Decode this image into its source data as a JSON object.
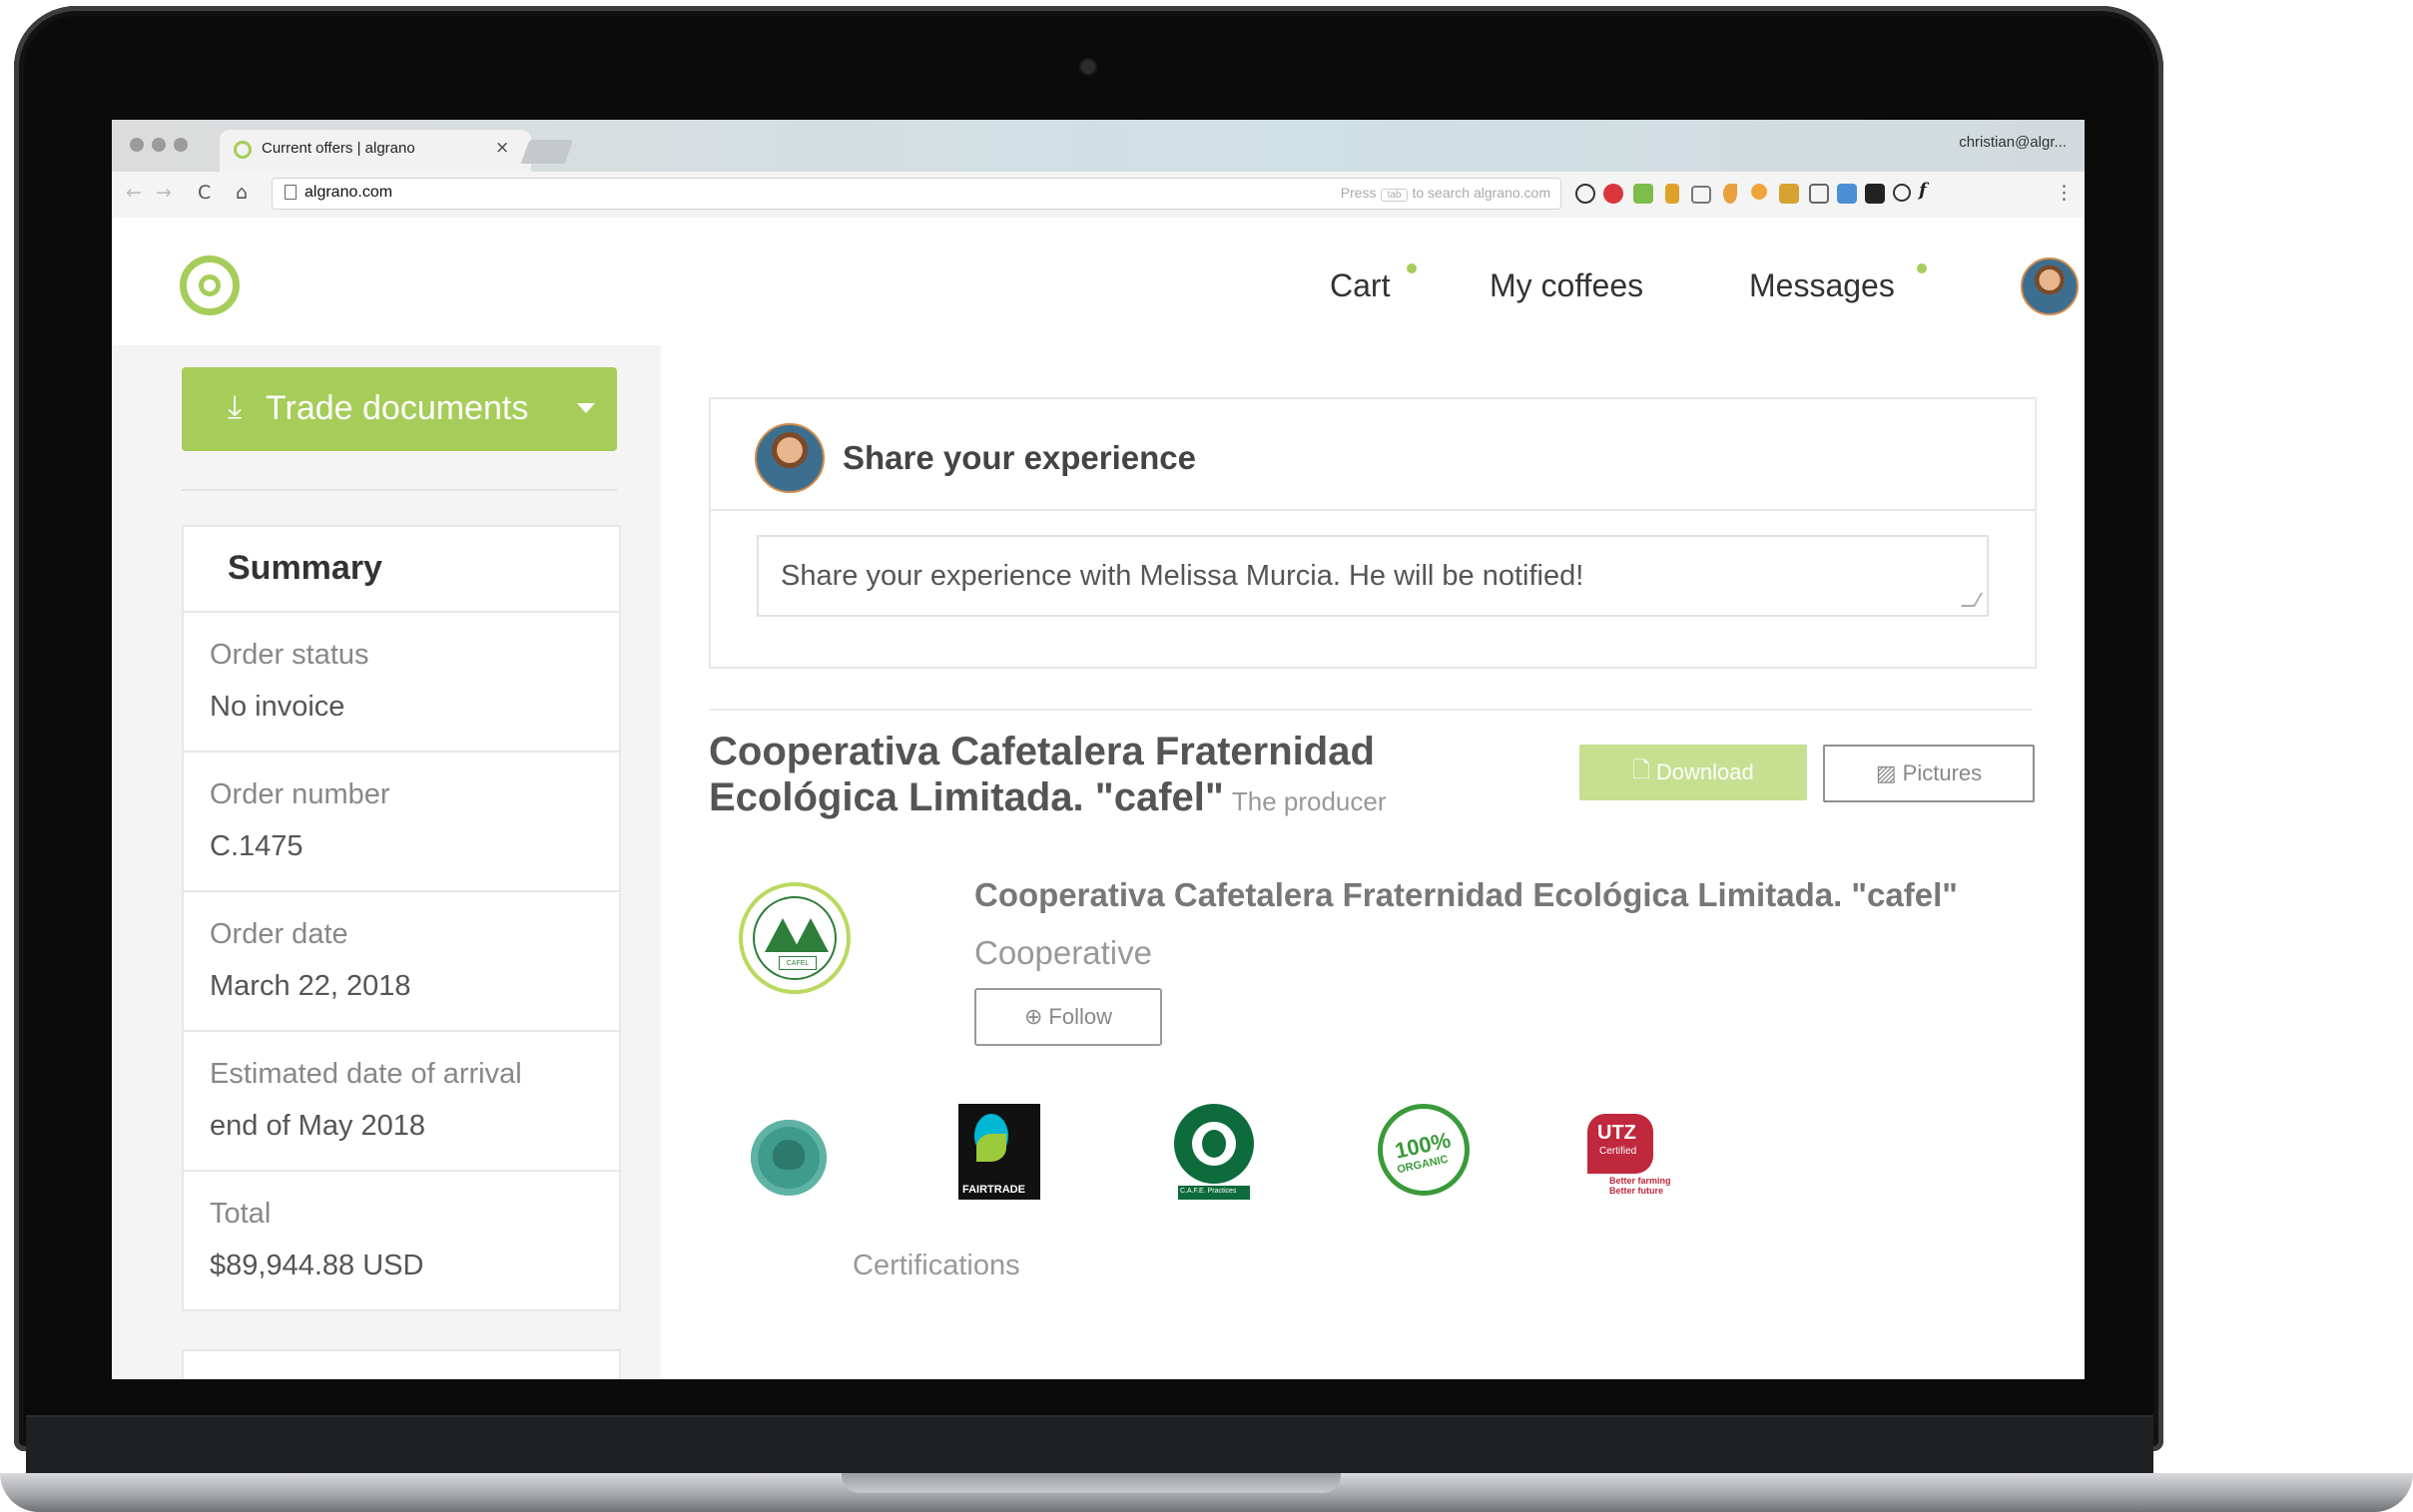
{
  "browser": {
    "tab_title": "Current offers | algrano",
    "tab_close": "×",
    "profile": "christian@algr...",
    "url": "algrano.com",
    "search_hint_before": "Press",
    "search_hint_key": "tab",
    "search_hint_after": "to search algrano.com",
    "nav": {
      "back": "←",
      "forward": "→",
      "reload": "C",
      "home": "⌂"
    },
    "menu": "⋮"
  },
  "header": {
    "nav": [
      {
        "label": "Cart",
        "badge": true
      },
      {
        "label": "My coffees",
        "badge": false
      },
      {
        "label": "Messages",
        "badge": true
      }
    ]
  },
  "left": {
    "trade_button": {
      "icon": "download-icon",
      "label": "Trade documents"
    },
    "summary": {
      "title": "Summary",
      "rows": [
        {
          "label": "Order status",
          "value": "No invoice"
        },
        {
          "label": "Order number",
          "value": "C.1475"
        },
        {
          "label": "Order date",
          "value": "March 22, 2018"
        },
        {
          "label": "Estimated date of arrival",
          "value": "end of May 2018"
        },
        {
          "label": "Total",
          "value": "$89,944.88 USD"
        }
      ]
    }
  },
  "share": {
    "title": "Share your experience",
    "placeholder": "Share your experience with Melissa Murcia. He will be notified!"
  },
  "producer": {
    "heading": "Cooperativa Cafetalera Fraternidad Ecológica Limitada. \"cafel\"",
    "subtitle": "The producer",
    "download_label": "Download",
    "pictures_label": "Pictures",
    "name": "Cooperativa Cafetalera Fraternidad Ecológica Limitada. \"cafel\"",
    "type": "Cooperative",
    "follow_label": "Follow",
    "logo_text": "CAFEL",
    "certifications_label": "Certifications",
    "cert_texts": {
      "fairtrade": "FAIRTRADE",
      "starbucks": "C.A.F.E. Practices",
      "organic_top": "100%",
      "organic_bottom": "ORGANIC",
      "utz_top": "UTZ",
      "utz_sub": "Certified",
      "utz_tag": "Better farming Better future"
    }
  },
  "colors": {
    "accent": "#a6cd5a",
    "text": "#333333",
    "muted": "#999999"
  }
}
